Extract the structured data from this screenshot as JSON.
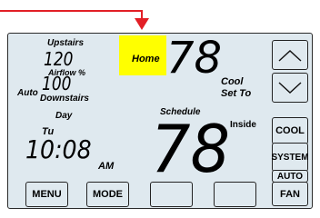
{
  "display": {
    "upstairs_label": "Upstairs",
    "upstairs_value": "120",
    "airflow_label": "Airflow %",
    "auto_label": "Auto",
    "auto_value": "100",
    "downstairs_label": "Downstairs",
    "day_label": "Day",
    "day_value": "Tu",
    "time_value": "10:08",
    "ampm": "AM",
    "home_label": "Home",
    "cool_setpoint": "78",
    "cool_set_to_label_line1": "Cool",
    "cool_set_to_label_line2": "Set To",
    "schedule_label": "Schedule",
    "inside_label": "Inside",
    "inside_temp": "78"
  },
  "buttons": {
    "menu": "MENU",
    "mode": "MODE",
    "cool": "COOL",
    "system": "SYSTEM",
    "auto": "AUTO",
    "fan": "FAN"
  },
  "colors": {
    "highlight": "#ffff00",
    "pointer": "#e21f26",
    "screen_background": "#dfe9ef"
  },
  "icons": {
    "pointer": "arrow-down-icon",
    "up": "chevron-up-icon",
    "down": "chevron-down-icon"
  }
}
